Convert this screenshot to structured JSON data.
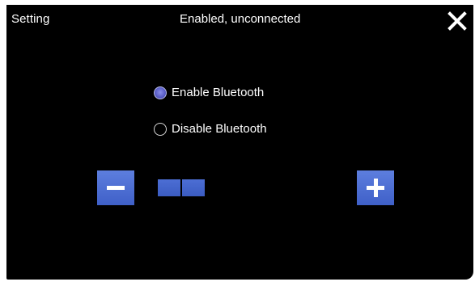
{
  "header": {
    "title": "Setting",
    "status": "Enabled, unconnected",
    "close_icon": "close-icon"
  },
  "bluetooth_options": [
    {
      "label": "Enable Bluetooth",
      "selected": true
    },
    {
      "label": "Disable Bluetooth",
      "selected": false
    }
  ],
  "level_control": {
    "decrease_icon": "minus-icon",
    "increase_icon": "plus-icon",
    "segments_filled": 2
  },
  "colors": {
    "background": "#000000",
    "accent": "#4a6bd2",
    "text": "#ffffff"
  }
}
